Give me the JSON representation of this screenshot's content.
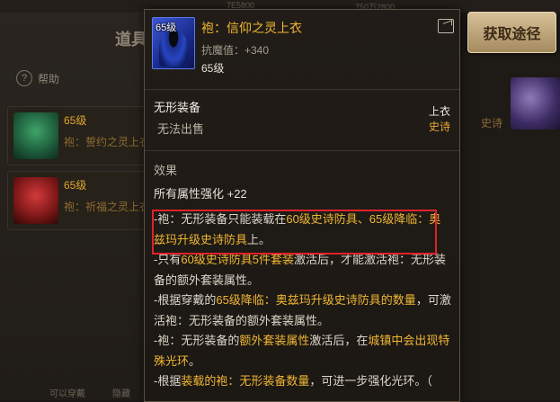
{
  "background": {
    "panel_title": "道具",
    "help_label": "帮助",
    "rows": [
      {
        "level": "65级",
        "name": "袍：誓约之灵上衣"
      },
      {
        "level": "65级",
        "name": "袍：祈福之灵上衣"
      }
    ],
    "epic_tag": "史诗",
    "bottom_left": "可以穿戴",
    "bottom_mid": "隐藏",
    "top_hint_left": "7E5800",
    "top_hint_right": "750万2800"
  },
  "get_button_label": "获取途径",
  "tooltip": {
    "icon_level": "65级",
    "item_name": "袍：信仰之灵上衣",
    "stat_line": "抗魔值：+340",
    "level_line": "65级",
    "type": "无形装备",
    "sell": "无法出售",
    "slot": "上衣",
    "rarity": "史诗",
    "effect_title": "效果",
    "all_attr": "所有属性强化 +22",
    "desc": [
      [
        {
          "t": "-袍：无形装备只能装载在",
          "y": false
        },
        {
          "t": "60级史诗防具、65级降临：奥兹玛升级史诗防具",
          "y": true
        },
        {
          "t": "上。",
          "y": false
        }
      ],
      [
        {
          "t": "-只有",
          "y": false
        },
        {
          "t": "60级史诗防具5件套装",
          "y": true
        },
        {
          "t": "激活后，才能激活袍：无形装备的额外套装属性。",
          "y": false
        }
      ],
      [
        {
          "t": "-根据穿戴的",
          "y": false
        },
        {
          "t": "65级降临：奥兹玛升级史诗防具的数量",
          "y": true
        },
        {
          "t": "，可激活袍：无形装备的额外套装属性。",
          "y": false
        }
      ],
      [
        {
          "t": "-袍：无形装备的",
          "y": false
        },
        {
          "t": "额外套装属性",
          "y": true
        },
        {
          "t": "激活后，在",
          "y": false
        },
        {
          "t": "城镇中会出现特殊光环",
          "y": true
        },
        {
          "t": "。",
          "y": false
        }
      ],
      [
        {
          "t": "-根据",
          "y": false
        },
        {
          "t": "装载的袍：无形装备数量",
          "y": true
        },
        {
          "t": "，可进一步强化光环。（",
          "y": false
        }
      ]
    ]
  },
  "colors": {
    "gold_text": "#f0b634",
    "epic_orange": "#e8a935",
    "highlight_red": "#e0222a",
    "button_gold": "#c8ae7e"
  }
}
